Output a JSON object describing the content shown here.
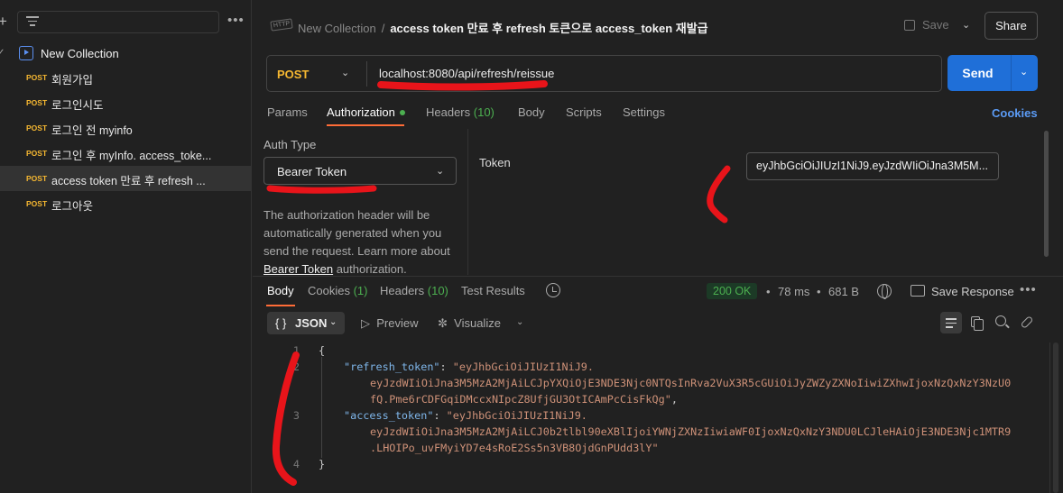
{
  "sidebar": {
    "plus_icon": "+",
    "more_icon": "•••",
    "collection": {
      "chevron": "✓",
      "name": "New Collection"
    },
    "requests": [
      {
        "method": "POST",
        "name": "회원가입"
      },
      {
        "method": "POST",
        "name": "로그인시도"
      },
      {
        "method": "POST",
        "name": "로그인 전 myinfo"
      },
      {
        "method": "POST",
        "name": "로그인 후 myInfo. access_toke..."
      },
      {
        "method": "POST",
        "name": "access token 만료 후 refresh ..."
      },
      {
        "method": "POST",
        "name": "로그아웃"
      }
    ]
  },
  "header": {
    "icon_label": "HTTP",
    "collection": "New Collection",
    "separator": "/",
    "request_title": "access token 만료 후 refresh 토큰으로 access_token 재발급",
    "save_label": "Save",
    "share_label": "Share"
  },
  "request": {
    "method": "POST",
    "url": "localhost:8080/api/refresh/reissue",
    "send_label": "Send"
  },
  "tabs": {
    "params": "Params",
    "authorization": "Authorization",
    "headers": "Headers",
    "headers_count": "(10)",
    "body": "Body",
    "scripts": "Scripts",
    "settings": "Settings",
    "cookies": "Cookies"
  },
  "auth": {
    "type_label": "Auth Type",
    "type_value": "Bearer Token",
    "desc_1": "The authorization header will be automatically generated when you send the request. Learn more about",
    "desc_link": "Bearer Token",
    "desc_2": " authorization.",
    "token_label": "Token",
    "token_value": "eyJhbGciOiJIUzI1NiJ9.eyJzdWIiOiJna3M5M..."
  },
  "response": {
    "tabs": {
      "body": "Body",
      "cookies": "Cookies",
      "cookies_count": "(1)",
      "headers": "Headers",
      "headers_count": "(10)",
      "test_results": "Test Results"
    },
    "status": "200 OK",
    "time": "78 ms",
    "size": "681 B",
    "sep": "•",
    "save_response": "Save Response",
    "format": "JSON",
    "format_brace": "{ }",
    "preview": "Preview",
    "visualize": "Visualize",
    "code": {
      "line_numbers": [
        "1",
        "2",
        "3",
        "4"
      ],
      "open": "{",
      "close": "}",
      "k1": "\"refresh_token\"",
      "v1a": "\"eyJhbGciOiJIUzI1NiJ9.",
      "v1b": "eyJzdWIiOiJna3M5MzA2MjAiLCJpYXQiOjE3NDE3Njc0NTQsInRva2VuX3R5cGUiOiJyZWZyZXNoIiwiZXhwIjoxNzQxNzY3NzU0",
      "v1c": "fQ.Pme6rCDFGqiDMccxNIpcZ8UfjGU3OtICAmPcCisFkQg\"",
      "k2": "\"access_token\"",
      "v2a": "\"eyJhbGciOiJIUzI1NiJ9.",
      "v2b": "eyJzdWIiOiJna3M5MzA2MjAiLCJ0b2tlbl90eXBlIjoiYWNjZXNzIiwiaWF0IjoxNzQxNzY3NDU0LCJleHAiOjE3NDE3Njc1MTR9",
      "v2c": ".LHOIPo_uvFMyiYD7e4sRoE2Ss5n3VB8OjdGnPUdd3lY\""
    }
  },
  "annotation_color": "#e8141a",
  "accent_colors": {
    "post": "#f5b731",
    "send": "#1f6fd8",
    "tab_underline": "#ff6c37",
    "ok": "#4caf50",
    "link": "#5b9bf5"
  }
}
